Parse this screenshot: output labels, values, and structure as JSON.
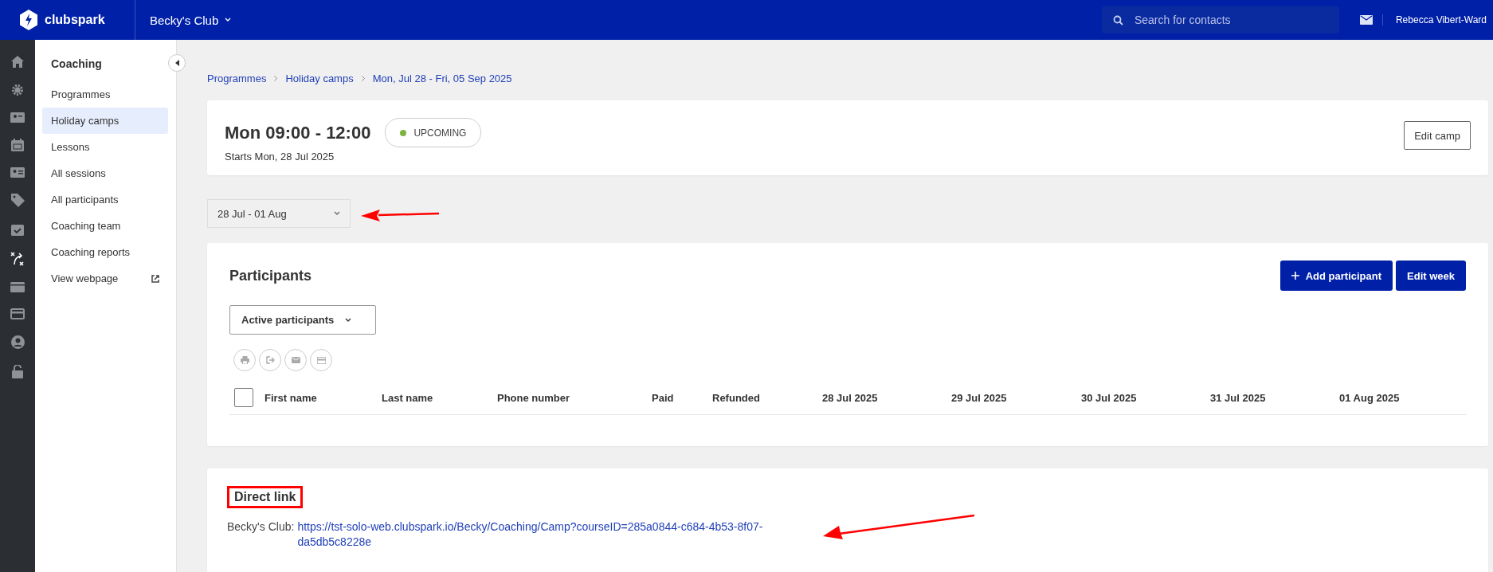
{
  "top_bar": {
    "logo": "clubspark",
    "club": "Becky's Club",
    "search": {
      "placeholder": "Search for contacts"
    },
    "user": "Rebecca Vibert-Ward"
  },
  "sidebar": {
    "heading": "Coaching",
    "items": [
      {
        "label": "Programmes",
        "selected": false,
        "external": false
      },
      {
        "label": "Holiday camps",
        "selected": true,
        "external": false
      },
      {
        "label": "Lessons",
        "selected": false,
        "external": false
      },
      {
        "label": "All sessions",
        "selected": false,
        "external": false
      },
      {
        "label": "All participants",
        "selected": false,
        "external": false
      },
      {
        "label": "Coaching team",
        "selected": false,
        "external": false
      },
      {
        "label": "Coaching reports",
        "selected": false,
        "external": false
      },
      {
        "label": "View webpage",
        "selected": false,
        "external": true
      }
    ]
  },
  "breadcrumbs": [
    "Programmes",
    "Holiday camps",
    "Mon, Jul 28 - Fri, 05 Sep 2025"
  ],
  "camp": {
    "title": "Mon 09:00 - 12:00",
    "subtitle": "Starts Mon, 28 Jul 2025",
    "status": {
      "label": "UPCOMING",
      "color": "#7cb342"
    },
    "edit_button": "Edit camp"
  },
  "week_select": {
    "value": "28 Jul - 01 Aug"
  },
  "participants": {
    "title": "Participants",
    "select_all_checked": false,
    "buttons": [
      {
        "label": "Add participant",
        "kind": "add"
      },
      {
        "label": "Edit week",
        "kind": "plain"
      }
    ],
    "filter": "Active participants",
    "columns": [
      "First name",
      "Last name",
      "Phone number",
      "Paid",
      "Refunded",
      "28 Jul 2025",
      "29 Jul 2025",
      "30 Jul 2025",
      "31 Jul 2025",
      "01 Aug 2025"
    ]
  },
  "direct_link": {
    "heading": "Direct link",
    "label": "Becky's Club:",
    "url": "https://tst-solo-web.clubspark.io/Becky/Coaching/Camp?courseID=285a0844-c684-4b53-8f07-da5db5c8228e"
  }
}
